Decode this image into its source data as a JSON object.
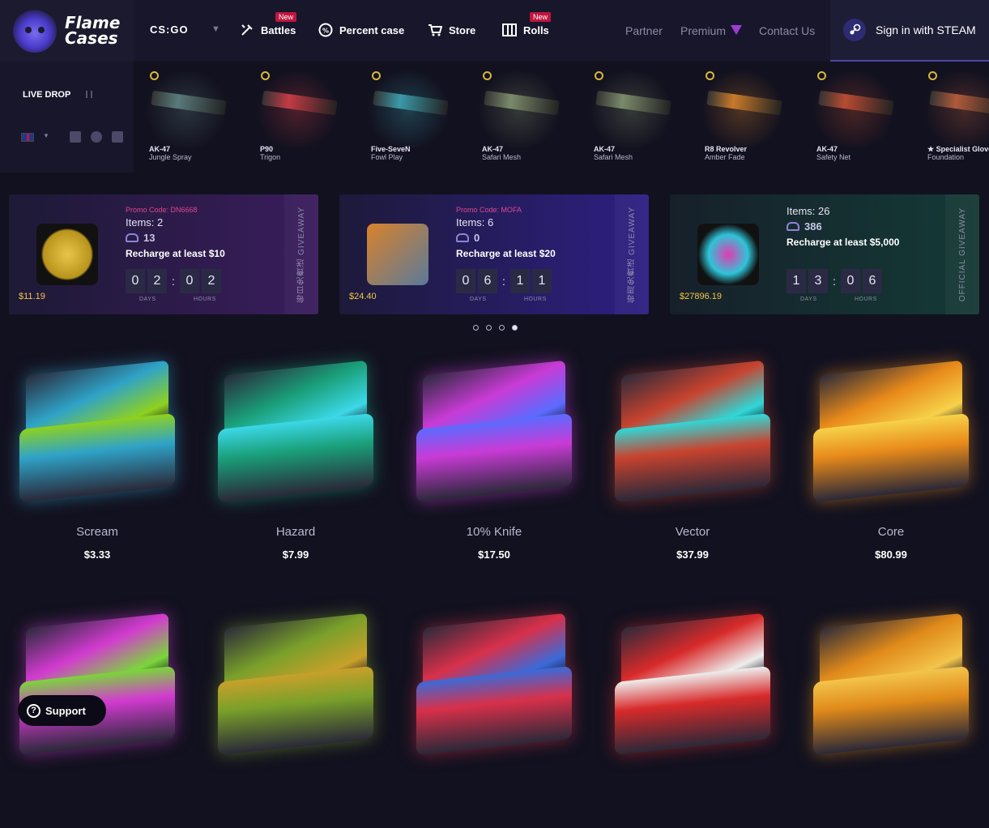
{
  "brand": {
    "line1": "Flame",
    "line2": "Cases"
  },
  "nav": {
    "game": "CS:GO",
    "items": [
      {
        "label": "Battles",
        "badge": "New",
        "icon": "battle-icon"
      },
      {
        "label": "Percent case",
        "icon": "percent-icon"
      },
      {
        "label": "Store",
        "icon": "cart-icon"
      },
      {
        "label": "Rolls",
        "badge": "New",
        "icon": "roll-icon"
      }
    ],
    "links": [
      "Partner",
      "Premium",
      "Contact Us"
    ],
    "signin": "Sign in with STEAM"
  },
  "live": {
    "label": "LIVE DROP",
    "drops": [
      {
        "weapon": "AK-47",
        "skin": "Jungle Spray",
        "color": "#5a7a7a"
      },
      {
        "weapon": "P90",
        "skin": "Trigon",
        "color": "#c23b44"
      },
      {
        "weapon": "Five-SeveN",
        "skin": "Fowl Play",
        "color": "#3a9aa8"
      },
      {
        "weapon": "AK-47",
        "skin": "Safari Mesh",
        "color": "#7b8a6a"
      },
      {
        "weapon": "AK-47",
        "skin": "Safari Mesh",
        "color": "#7b8a6a"
      },
      {
        "weapon": "R8 Revolver",
        "skin": "Amber Fade",
        "color": "#c87a2a"
      },
      {
        "weapon": "AK-47",
        "skin": "Safety Net",
        "color": "#b84b32"
      },
      {
        "weapon": "★ Specialist Gloves",
        "skin": "Foundation",
        "color": "#b05a3a"
      }
    ]
  },
  "giveaways": [
    {
      "promo": "Promo Code: DN6668",
      "items": "Items: 2",
      "users": "13",
      "recharge": "Recharge at least $10",
      "timer": [
        "0",
        "2",
        "0",
        "2"
      ],
      "amount": "$11.19",
      "side": "每日免費送 GIVEAWAY",
      "days": "DAYS",
      "hours": "HOURS"
    },
    {
      "promo": "Promo Code: MOFA",
      "items": "Items: 6",
      "users": "0",
      "recharge": "Recharge at least $20",
      "timer": [
        "0",
        "6",
        "1",
        "1"
      ],
      "amount": "$24.40",
      "side": "每周免費送 GIVEAWAY",
      "days": "DAYS",
      "hours": "HOURS"
    },
    {
      "promo": "",
      "items": "Items: 26",
      "users": "386",
      "recharge": "Recharge at least $5,000",
      "timer": [
        "1",
        "3",
        "0",
        "6"
      ],
      "amount": "$27896.19",
      "side": "OFFICIAL GIVEAWAY",
      "days": "DAYS",
      "hours": "HOURS"
    }
  ],
  "cases_row1": [
    {
      "name": "Scream",
      "price": "$3.33",
      "color": "#2fa3c8",
      "accent": "#8ed11f"
    },
    {
      "name": "Hazard",
      "price": "$7.99",
      "color": "#1aa07a",
      "accent": "#3cd8e8"
    },
    {
      "name": "10% Knife",
      "price": "$17.50",
      "color": "#c93bd6",
      "accent": "#5b6bff"
    },
    {
      "name": "Vector",
      "price": "$37.99",
      "color": "#c8432f",
      "accent": "#2fd8d8"
    },
    {
      "name": "Core",
      "price": "$80.99",
      "color": "#e88a1a",
      "accent": "#f7d24a"
    }
  ],
  "cases_row2": [
    {
      "color": "#d23bd0",
      "accent": "#7bd63a"
    },
    {
      "color": "#7aa02a",
      "accent": "#c8a02a"
    },
    {
      "color": "#d8304a",
      "accent": "#3a6ad8"
    },
    {
      "color": "#d82a2a",
      "accent": "#eeeeee"
    },
    {
      "color": "#e08a1a",
      "accent": "#f3c44b"
    }
  ],
  "support": "Support"
}
